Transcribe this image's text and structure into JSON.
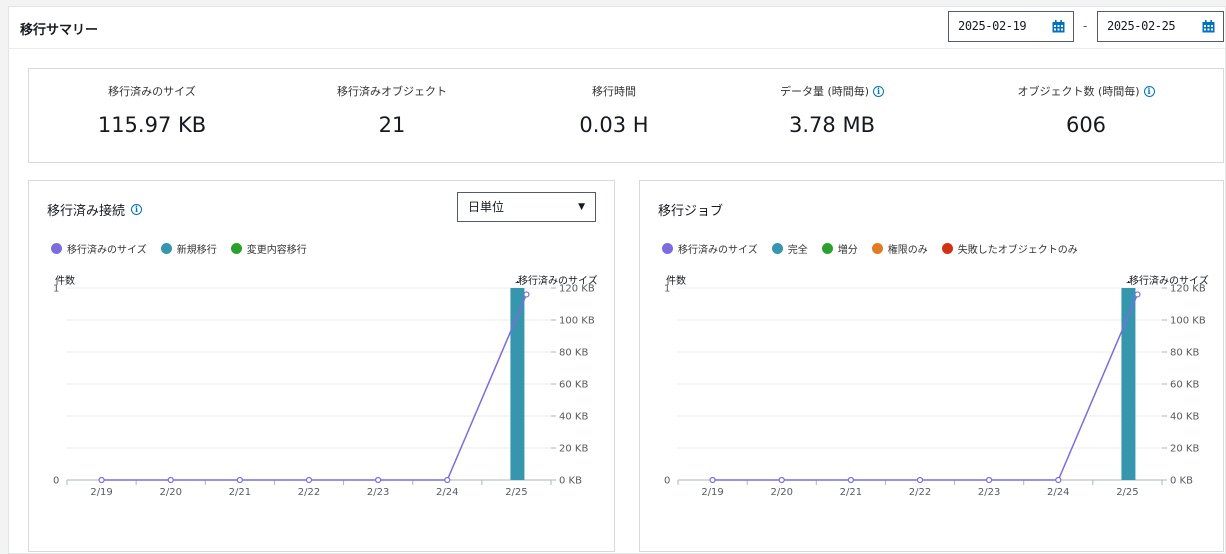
{
  "header": {
    "title": "移行サマリー",
    "date_from": "2025-02-19",
    "date_to": "2025-02-25",
    "date_sep": "-"
  },
  "summary": {
    "metrics": [
      {
        "label": "移行済みのサイズ",
        "value": "115.97 KB",
        "info": false
      },
      {
        "label": "移行済みオブジェクト",
        "value": "21",
        "info": false
      },
      {
        "label": "移行時間",
        "value": "0.03 H",
        "info": false
      },
      {
        "label": "データ量 (時間毎)",
        "value": "3.78 MB",
        "info": true
      },
      {
        "label": "オブジェクト数 (時間毎)",
        "value": "606",
        "info": true
      }
    ]
  },
  "colors": {
    "purple": "#7d6be0",
    "teal": "#3696ad",
    "green": "#2ca02c",
    "orange": "#e07b24",
    "red": "#d13212",
    "accent": "#0073bb"
  },
  "left_card": {
    "title": "移行済み接続",
    "select_value": "日単位",
    "legend": [
      {
        "label": "移行済みのサイズ",
        "color": "#7d6be0"
      },
      {
        "label": "新規移行",
        "color": "#3696ad"
      },
      {
        "label": "変更内容移行",
        "color": "#2ca02c"
      }
    ],
    "left_axis_title": "件数",
    "right_axis_title": "移行済みのサイズ"
  },
  "right_card": {
    "title": "移行ジョブ",
    "legend": [
      {
        "label": "移行済みのサイズ",
        "color": "#7d6be0"
      },
      {
        "label": "完全",
        "color": "#3696ad"
      },
      {
        "label": "増分",
        "color": "#2ca02c"
      },
      {
        "label": "権限のみ",
        "color": "#e07b24"
      },
      {
        "label": "失敗したオブジェクトのみ",
        "color": "#d13212"
      }
    ],
    "left_axis_title": "件数",
    "right_axis_title": "移行済みのサイズ"
  },
  "chart_data": [
    {
      "type": "bar",
      "categories": [
        "2/19",
        "2/20",
        "2/21",
        "2/22",
        "2/23",
        "2/24",
        "2/25"
      ],
      "left_ticks": [
        "0",
        "1"
      ],
      "right_ticks": [
        "0 KB",
        "20 KB",
        "40 KB",
        "60 KB",
        "80 KB",
        "100 KB",
        "120 KB"
      ],
      "series": [
        {
          "name": "新規移行",
          "kind": "bar",
          "values": [
            0,
            0,
            0,
            0,
            0,
            0,
            1
          ],
          "labels": [
            "",
            "",
            "",
            "",
            "",
            "",
            "1"
          ]
        },
        {
          "name": "移行済みのサイズ",
          "kind": "line",
          "values": [
            0,
            0,
            0,
            0,
            0,
            0,
            115.97
          ]
        }
      ],
      "ylim": [
        0,
        1
      ],
      "y2lim": [
        0,
        120
      ]
    },
    {
      "type": "bar",
      "categories": [
        "2/19",
        "2/20",
        "2/21",
        "2/22",
        "2/23",
        "2/24",
        "2/25"
      ],
      "left_ticks": [
        "0",
        "1"
      ],
      "right_ticks": [
        "0 KB",
        "20 KB",
        "40 KB",
        "60 KB",
        "80 KB",
        "100 KB",
        "120 KB"
      ],
      "series": [
        {
          "name": "完全",
          "kind": "bar",
          "values": [
            0,
            0,
            0,
            0,
            0,
            0,
            1
          ],
          "labels": [
            "",
            "",
            "",
            "",
            "",
            "",
            "1"
          ]
        },
        {
          "name": "移行済みのサイズ",
          "kind": "line",
          "values": [
            0,
            0,
            0,
            0,
            0,
            0,
            115.97
          ]
        }
      ],
      "ylim": [
        0,
        1
      ],
      "y2lim": [
        0,
        120
      ]
    }
  ]
}
